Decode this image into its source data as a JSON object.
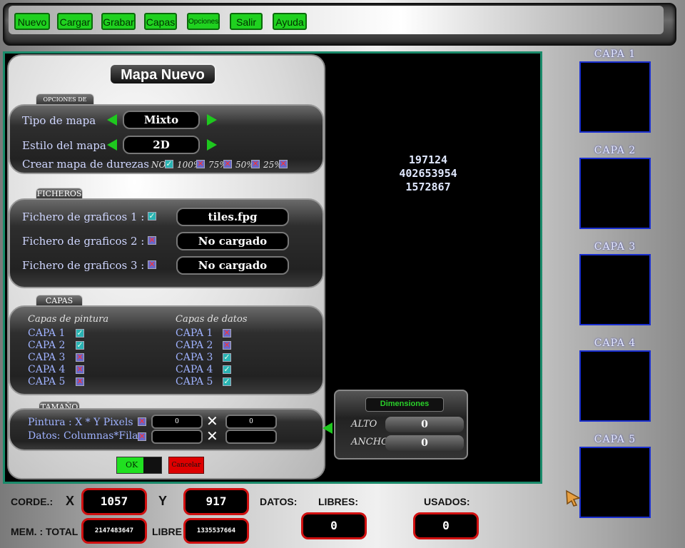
{
  "toolbar": {
    "buttons": [
      "Nuevo",
      "Cargar",
      "Grabar",
      "Capas",
      "Opciones",
      "Salir",
      "Ayuda"
    ]
  },
  "dialog": {
    "title": "Mapa Nuevo",
    "opciones": {
      "tab": "OPCIONES DE MAPA",
      "tipo_label": "Tipo de mapa",
      "tipo_value": "Mixto",
      "estilo_label": "Estilo del mapa",
      "estilo_value": "2D",
      "durezas_label": "Crear mapa de durezas",
      "durezas_options": [
        "NO",
        "100%",
        "75%",
        "50%",
        "25%"
      ]
    },
    "ficheros": {
      "tab": "FICHEROS",
      "items": [
        {
          "label": "Fichero de graficos 1 :",
          "value": "tiles.fpg"
        },
        {
          "label": "Fichero de graficos 2 :",
          "value": "No cargado"
        },
        {
          "label": "Fichero de graficos 3 :",
          "value": "No cargado"
        }
      ]
    },
    "capas": {
      "tab": "CAPAS",
      "pintura_title": "Capas de pintura",
      "datos_title": "Capas de datos",
      "pintura": [
        "CAPA 1",
        "CAPA 2",
        "CAPA 3",
        "CAPA 4",
        "CAPA 5"
      ],
      "datos": [
        "CAPA 1",
        "CAPA 2",
        "CAPA 3",
        "CAPA 4",
        "CAPA 5"
      ]
    },
    "tamano": {
      "tab": "TAMAÑO",
      "pintura_label": "Pintura : X * Y Pixels",
      "datos_label": "Datos: Columnas*Filas",
      "x_value": "0",
      "y_value": "0",
      "times": "✕"
    },
    "ok": "OK",
    "cancel": "Cancelar"
  },
  "canvas_numbers": [
    "197124",
    "402653954",
    "1572867"
  ],
  "dimensiones": {
    "title": "Dimensiones",
    "alto_label": "ALTO",
    "alto_value": "0",
    "ancho_label": "ANCHO",
    "ancho_value": "0"
  },
  "layers": [
    "CAPA  1",
    "CAPA  2",
    "CAPA  3",
    "CAPA  4",
    "CAPA  5"
  ],
  "status": {
    "corde": "CORDE.:",
    "x_label": "X",
    "x_value": "1057",
    "y_label": "Y",
    "y_value": "917",
    "datos": "DATOS:",
    "libres": "LIBRES:",
    "usados": "USADOS:",
    "libres_value": "0",
    "usados_value": "0",
    "mem_total": "MEM. : TOTAL",
    "total_value": "2147483647",
    "libre": "LIBRE",
    "libre_value": "1335537664"
  },
  "colors": {
    "accent_green": "#1fd11f",
    "alert_red": "#d01010",
    "layer_border": "#1a2fd0"
  }
}
